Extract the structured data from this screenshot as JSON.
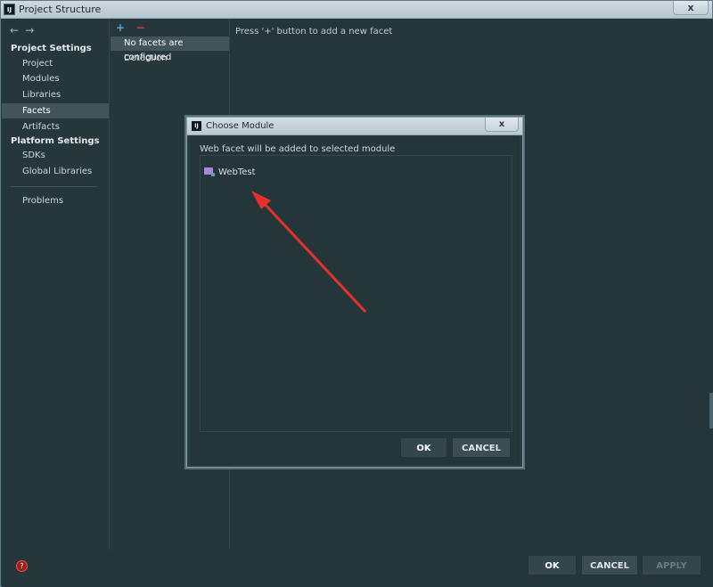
{
  "window": {
    "title": "Project Structure",
    "app_icon": "IJ",
    "close": "x"
  },
  "nav": {
    "back": "←",
    "forward": "→",
    "project_settings": "Project Settings",
    "items_project": [
      "Project",
      "Modules",
      "Libraries",
      "Facets",
      "Artifacts"
    ],
    "platform_settings": "Platform Settings",
    "items_platform": [
      "SDKs",
      "Global Libraries"
    ],
    "problems": "Problems",
    "selected": "Facets"
  },
  "facets": {
    "add": "+",
    "remove": "−",
    "items": [
      "No facets are configured",
      "Detection"
    ]
  },
  "hint": "Press '+' button to add a new facet",
  "dialog": {
    "title": "Choose Module",
    "app_icon": "IJ",
    "close": "x",
    "caption": "Web facet will be added to selected module",
    "module": "WebTest",
    "ok": "OK",
    "cancel": "CANCEL"
  },
  "footer": {
    "help": "?",
    "ok": "OK",
    "cancel": "CANCEL",
    "apply": "APPLY"
  },
  "colors": {
    "annotation_arrow": "#e8302b"
  }
}
